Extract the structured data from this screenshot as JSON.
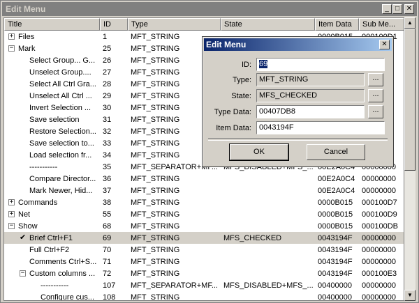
{
  "window": {
    "title": "Edit Menu"
  },
  "columns": [
    "Title",
    "ID",
    "Type",
    "State",
    "Item Data",
    "Sub Me..."
  ],
  "rows": [
    {
      "title": "Files",
      "indent": 0,
      "exp": "+",
      "id": "1",
      "type": "MFT_STRING",
      "state": "",
      "data": "0000B015",
      "sub": "000100D1"
    },
    {
      "title": "Mark",
      "indent": 0,
      "exp": "−",
      "id": "25",
      "type": "MFT_STRING",
      "state": "",
      "data": "",
      "sub": ""
    },
    {
      "title": "Select Group... G...",
      "indent": 2,
      "exp": "",
      "id": "26",
      "type": "MFT_STRING",
      "state": "",
      "data": "",
      "sub": ""
    },
    {
      "title": "Unselect Group....",
      "indent": 2,
      "exp": "",
      "id": "27",
      "type": "MFT_STRING",
      "state": "",
      "data": "",
      "sub": ""
    },
    {
      "title": "Select All Ctrl Gra...",
      "indent": 2,
      "exp": "",
      "id": "28",
      "type": "MFT_STRING",
      "state": "",
      "data": "",
      "sub": ""
    },
    {
      "title": "Unselect All Ctrl ...",
      "indent": 2,
      "exp": "",
      "id": "29",
      "type": "MFT_STRING",
      "state": "",
      "data": "",
      "sub": ""
    },
    {
      "title": "Invert Selection ...",
      "indent": 2,
      "exp": "",
      "id": "30",
      "type": "MFT_STRING",
      "state": "",
      "data": "",
      "sub": ""
    },
    {
      "title": "Save selection",
      "indent": 2,
      "exp": "",
      "id": "31",
      "type": "MFT_STRING",
      "state": "",
      "data": "",
      "sub": ""
    },
    {
      "title": "Restore Selection...",
      "indent": 2,
      "exp": "",
      "id": "32",
      "type": "MFT_STRING",
      "state": "",
      "data": "",
      "sub": ""
    },
    {
      "title": "Save selection to...",
      "indent": 2,
      "exp": "",
      "id": "33",
      "type": "MFT_STRING",
      "state": "",
      "data": "",
      "sub": ""
    },
    {
      "title": "Load selection fr...",
      "indent": 2,
      "exp": "",
      "id": "34",
      "type": "MFT_STRING",
      "state": "",
      "data": "",
      "sub": ""
    },
    {
      "title": "-----------",
      "indent": 2,
      "exp": "",
      "id": "35",
      "type": "MFT_SEPARATOR+MF...",
      "state": "MFS_DISABLED+MFS_...",
      "data": "00E2A0C4",
      "sub": "00000000"
    },
    {
      "title": "Compare Director...",
      "indent": 2,
      "exp": "",
      "id": "36",
      "type": "MFT_STRING",
      "state": "",
      "data": "00E2A0C4",
      "sub": "00000000"
    },
    {
      "title": "Mark Newer, Hid...",
      "indent": 2,
      "exp": "",
      "id": "37",
      "type": "MFT_STRING",
      "state": "",
      "data": "00E2A0C4",
      "sub": "00000000"
    },
    {
      "title": "Commands",
      "indent": 0,
      "exp": "+",
      "id": "38",
      "type": "MFT_STRING",
      "state": "",
      "data": "0000B015",
      "sub": "000100D7"
    },
    {
      "title": "Net",
      "indent": 0,
      "exp": "+",
      "id": "55",
      "type": "MFT_STRING",
      "state": "",
      "data": "0000B015",
      "sub": "000100D9"
    },
    {
      "title": "Show",
      "indent": 0,
      "exp": "−",
      "id": "68",
      "type": "MFT_STRING",
      "state": "",
      "data": "0000B015",
      "sub": "000100DB"
    },
    {
      "title": "Brief Ctrl+F1",
      "indent": 2,
      "exp": "",
      "check": true,
      "sel": true,
      "id": "69",
      "type": "MFT_STRING",
      "state": "MFS_CHECKED",
      "data": "0043194F",
      "sub": "00000000"
    },
    {
      "title": "Full Ctrl+F2",
      "indent": 2,
      "exp": "",
      "id": "70",
      "type": "MFT_STRING",
      "state": "",
      "data": "0043194F",
      "sub": "00000000"
    },
    {
      "title": "Comments Ctrl+S...",
      "indent": 2,
      "exp": "",
      "id": "71",
      "type": "MFT_STRING",
      "state": "",
      "data": "0043194F",
      "sub": "00000000"
    },
    {
      "title": "Custom columns ...",
      "indent": 1,
      "exp": "−",
      "id": "72",
      "type": "MFT_STRING",
      "state": "",
      "data": "0043194F",
      "sub": "000100E3"
    },
    {
      "title": "-----------",
      "indent": 3,
      "exp": "",
      "id": "107",
      "type": "MFT_SEPARATOR+MF...",
      "state": "MFS_DISABLED+MFS_...",
      "data": "00400000",
      "sub": "00000000"
    },
    {
      "title": "Configure cus...",
      "indent": 3,
      "exp": "",
      "id": "108",
      "type": "MFT_STRING",
      "state": "",
      "data": "00400000",
      "sub": "00000000"
    }
  ],
  "dialog": {
    "title": "Edit Menu",
    "id_label": "ID:",
    "id_value": "69",
    "type_label": "Type:",
    "type_value": "MFT_STRING",
    "state_label": "State:",
    "state_value": "MFS_CHECKED",
    "typedata_label": "Type Data:",
    "typedata_value": "00407DB8",
    "itemdata_label": "Item Data:",
    "itemdata_value": "0043194F",
    "browse_label": "...",
    "ok_label": "OK",
    "cancel_label": "Cancel"
  },
  "icons": {
    "minimize": "minimize-icon",
    "maximize": "maximize-icon",
    "close": "close-icon",
    "check": "check-icon"
  }
}
